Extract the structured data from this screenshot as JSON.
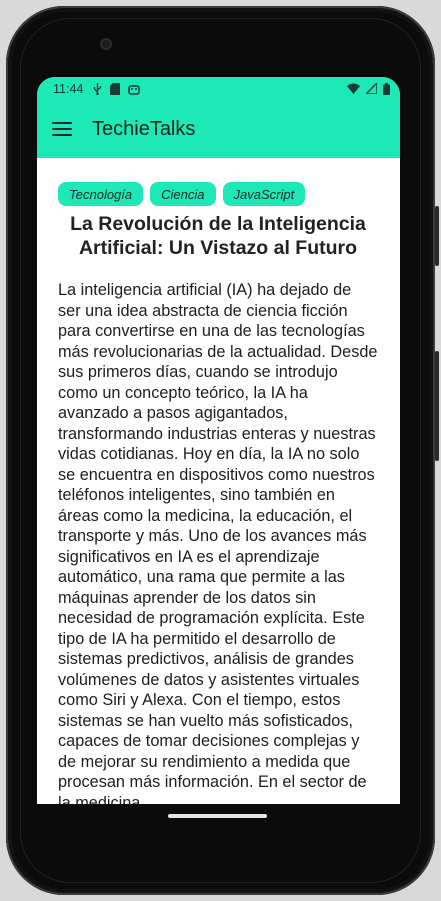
{
  "status_bar": {
    "time": "11:44",
    "left_icons": [
      "usb-debug-icon",
      "sd-card-icon",
      "android-debug-icon"
    ],
    "right_icons": [
      "wifi-icon",
      "signal-icon",
      "battery-icon"
    ]
  },
  "app_bar": {
    "title": "TechieTalks",
    "menu_icon": "hamburger-menu-icon"
  },
  "tags": [
    "Tecnología",
    "Ciencia",
    "JavaScript"
  ],
  "article": {
    "title": "La Revolución de la Inteligencia Artificial: Un Vistazo al Futuro",
    "body": "La inteligencia artificial (IA) ha dejado de ser una idea abstracta de ciencia ficción para convertirse en una de las tecnologías más revolucionarias de la actualidad. Desde sus primeros días, cuando se introdujo como un concepto teórico, la IA ha avanzado a pasos agigantados, transformando industrias enteras y nuestras vidas cotidianas. Hoy en día, la IA no solo se encuentra en dispositivos como nuestros teléfonos inteligentes, sino también en áreas como la medicina, la educación, el transporte y más. Uno de los avances más significativos en IA es el aprendizaje automático, una rama que permite a las máquinas aprender de los datos sin necesidad de programación explícita. Este tipo de IA ha permitido el desarrollo de sistemas predictivos, análisis de grandes volúmenes de datos y asistentes virtuales como Siri y Alexa. Con el tiempo, estos sistemas se han vuelto más sofisticados, capaces de tomar decisiones complejas y de mejorar su rendimiento a medida que procesan más información. En el sector de la medicina"
  },
  "colors": {
    "accent": "#1de9b6",
    "background": "#ffffff"
  }
}
